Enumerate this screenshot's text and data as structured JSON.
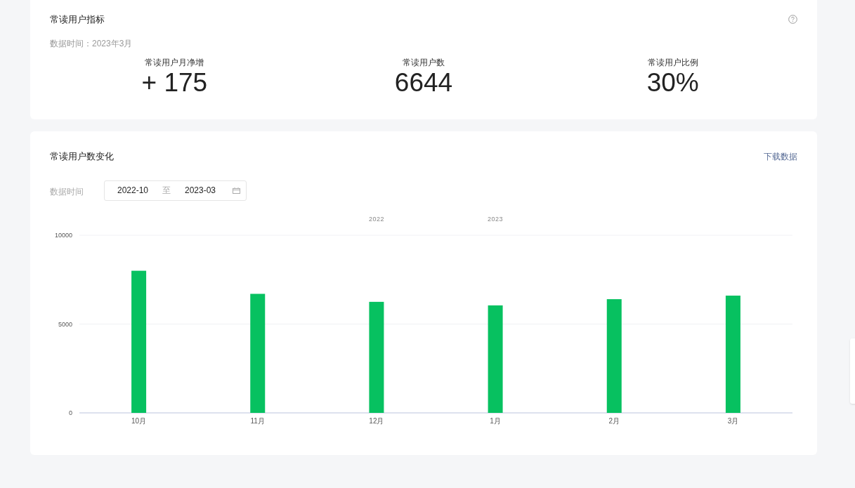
{
  "indicator_card": {
    "title": "常读用户指标",
    "data_time": "数据时间：2023年3月",
    "metrics": [
      {
        "label": "常读用户月净增",
        "value": "+ 175"
      },
      {
        "label": "常读用户数",
        "value": "6644"
      },
      {
        "label": "常读用户比例",
        "value": "30%"
      }
    ]
  },
  "trend_card": {
    "title": "常读用户数变化",
    "download_link": "下载数据",
    "date_label": "数据时间",
    "date_range": {
      "start": "2022-10",
      "separator": "至",
      "end": "2023-03"
    },
    "chart_data": {
      "type": "bar",
      "categories": [
        "10月",
        "11月",
        "12月",
        "1月",
        "2月",
        "3月"
      ],
      "series": [
        {
          "color": "#07c160",
          "values": [
            8000,
            6700,
            6250,
            6050,
            6400,
            6600
          ]
        }
      ],
      "ylim": [
        0,
        10000
      ],
      "yticks": [
        0,
        5000,
        10000
      ],
      "annotations": [
        "2022",
        "2023"
      ]
    }
  }
}
